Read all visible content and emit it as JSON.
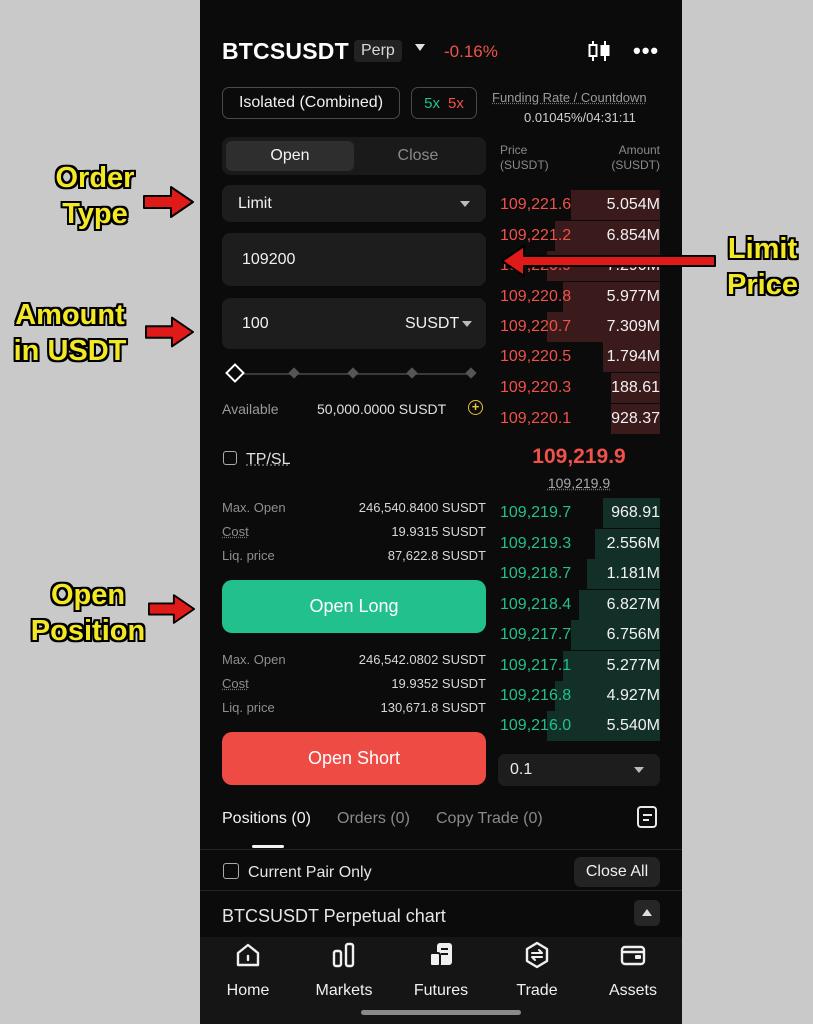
{
  "header": {
    "pair": "BTCSUSDT",
    "contract_type": "Perp",
    "change": "-0.16%"
  },
  "margin": {
    "mode": "Isolated (Combined)",
    "long_leverage": "5x",
    "short_leverage": "5x"
  },
  "funding": {
    "label": "Funding Rate / Countdown",
    "value": "0.01045%/04:31:11"
  },
  "trade_side": {
    "open": "Open",
    "close": "Close"
  },
  "form": {
    "order_type": "Limit",
    "price": "109200",
    "amount": "100",
    "amount_unit": "SUSDT",
    "slider_fraction": 0,
    "available_label": "Available",
    "available_value": "50,000.0000 SUSDT",
    "tpsl_label": "TP/SL"
  },
  "long_info": [
    {
      "label": "Max. Open",
      "value": "246,540.8400 SUSDT"
    },
    {
      "label": "Cost",
      "value": "19.9315 SUSDT"
    },
    {
      "label": "Liq. price",
      "value": "87,622.8 SUSDT"
    }
  ],
  "short_info": [
    {
      "label": "Max. Open",
      "value": "246,542.0802 SUSDT"
    },
    {
      "label": "Cost",
      "value": "19.9352 SUSDT"
    },
    {
      "label": "Liq. price",
      "value": "130,671.8 SUSDT"
    }
  ],
  "buttons": {
    "open_long": "Open Long",
    "open_short": "Open Short",
    "close_all": "Close All"
  },
  "orderbook": {
    "price_header": "Price",
    "price_header_unit": "(SUSDT)",
    "amount_header": "Amount",
    "amount_header_unit": "(SUSDT)",
    "asks": [
      {
        "price": "109,221.6",
        "amount": "5.054M",
        "depth": 0.55
      },
      {
        "price": "109,221.2",
        "amount": "6.854M",
        "depth": 0.65
      },
      {
        "price": "109,220.9",
        "amount": "7.290M",
        "depth": 0.7
      },
      {
        "price": "109,220.8",
        "amount": "5.977M",
        "depth": 0.6
      },
      {
        "price": "109,220.7",
        "amount": "7.309M",
        "depth": 0.7
      },
      {
        "price": "109,220.5",
        "amount": "1.794M",
        "depth": 0.35
      },
      {
        "price": "109,220.3",
        "amount": "188.61",
        "depth": 0.3
      },
      {
        "price": "109,220.1",
        "amount": "928.37",
        "depth": 0.3
      }
    ],
    "last_price": "109,219.9",
    "mark_price": "109,219.9",
    "bids": [
      {
        "price": "109,219.7",
        "amount": "968.91",
        "depth": 0.35
      },
      {
        "price": "109,219.3",
        "amount": "2.556M",
        "depth": 0.4
      },
      {
        "price": "109,218.7",
        "amount": "1.181M",
        "depth": 0.45
      },
      {
        "price": "109,218.4",
        "amount": "6.827M",
        "depth": 0.5
      },
      {
        "price": "109,217.7",
        "amount": "6.756M",
        "depth": 0.55
      },
      {
        "price": "109,217.1",
        "amount": "5.277M",
        "depth": 0.6
      },
      {
        "price": "109,216.8",
        "amount": "4.927M",
        "depth": 0.65
      },
      {
        "price": "109,216.0",
        "amount": "5.540M",
        "depth": 0.7
      }
    ],
    "depth_step": "0.1"
  },
  "tabs": {
    "positions": "Positions (0)",
    "orders": "Orders (0)",
    "copy_trade": "Copy Trade (0)"
  },
  "filter": {
    "current_pair_only": "Current Pair Only"
  },
  "chart_section": {
    "label": "BTCSUSDT Perpetual chart"
  },
  "nav": [
    {
      "label": "Home",
      "icon": "home-icon"
    },
    {
      "label": "Markets",
      "icon": "markets-icon"
    },
    {
      "label": "Futures",
      "icon": "futures-icon"
    },
    {
      "label": "Trade",
      "icon": "trade-icon"
    },
    {
      "label": "Assets",
      "icon": "wallet-icon"
    }
  ],
  "annotations": {
    "order_type": "Order\nType",
    "amount": "Amount\nin USDT",
    "open_position": "Open\nPosition",
    "limit_price": "Limit\nPrice"
  },
  "colors": {
    "long": "#22c08d",
    "short": "#ef4b45",
    "annotation": "#f3e824",
    "arrow": "#e01919"
  }
}
